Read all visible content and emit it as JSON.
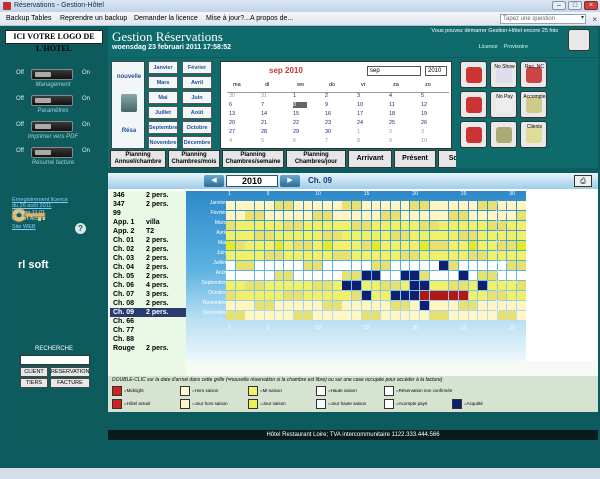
{
  "window": {
    "title": "Réservations - Gestion-Hôtel"
  },
  "menu": {
    "items": [
      "Backup Tables",
      "Reprendre un backup",
      "Demander la licence",
      "Mise à jour?...",
      "A propos de..."
    ],
    "search_placeholder": "Tapez une question",
    "close": "×"
  },
  "left": {
    "logo": "ICI VOTRE LOGO DE L'HOTEL",
    "toggles": [
      {
        "off": "Off",
        "on": "On",
        "label": "Management"
      },
      {
        "off": "Off",
        "on": "On",
        "label": "Paramètres"
      },
      {
        "off": "Off",
        "on": "On",
        "label": "Imprimer vers PDF"
      },
      {
        "off": "Off",
        "on": "On",
        "label": "Résumé facture"
      }
    ],
    "info_lines": [
      "Enregistrement licence",
      "du 26 août 2011",
      "Version  11.01",
      "Ouvert  Accès",
      "Site WEB"
    ],
    "help": "?",
    "brand": "rl soft",
    "search_label": "RECHERCHE",
    "buttons": [
      "CLIENT",
      "RESERVATION",
      "TIERS",
      "FACTURE"
    ]
  },
  "header": {
    "app": "Gestion Réservations",
    "datetime": "woensdag 23 februari 2011     17:58:52",
    "trial": "Vous pouvez démarrer Gestion-Hôtel encore 25 fois",
    "licence": "Licence",
    "licence_value": "Provisoire"
  },
  "calendar": {
    "nouvelle": "nouvelle",
    "resa": "Résa",
    "months": [
      "Janvier",
      "Février",
      "Mars",
      "Avril",
      "Mai",
      "Juin",
      "Juillet",
      "Août",
      "Septembre",
      "Octobre",
      "Novembre",
      "Décembre"
    ],
    "title": "sep 2010",
    "month_select": "sep",
    "year_select": "2010",
    "weekdays": [
      "ma",
      "di",
      "wo",
      "do",
      "vr",
      "za",
      "zo"
    ],
    "weeks": [
      [
        "30",
        "31",
        "1",
        "2",
        "3",
        "4",
        "5"
      ],
      [
        "6",
        "7",
        "8",
        "9",
        "10",
        "11",
        "12"
      ],
      [
        "13",
        "14",
        "15",
        "16",
        "17",
        "18",
        "19"
      ],
      [
        "20",
        "21",
        "22",
        "23",
        "24",
        "25",
        "26"
      ],
      [
        "27",
        "28",
        "29",
        "30",
        "1",
        "2",
        "3"
      ],
      [
        "4",
        "5",
        "6",
        "7",
        "8",
        "9",
        "10"
      ]
    ]
  },
  "tabs": [
    {
      "l1": "Planning",
      "l2": "Annuel/chambre"
    },
    {
      "l1": "Planning",
      "l2": "Chambres/mois"
    },
    {
      "l1": "Planning",
      "l2": "Chambres/semaine"
    },
    {
      "l1": "Planning",
      "l2": "Chambres/jour"
    },
    {
      "l1": "Arrivant",
      "l2": ""
    },
    {
      "l1": "Présent",
      "l2": ""
    },
    {
      "l1": "Sortant",
      "l2": ""
    },
    {
      "l1": "Libre",
      "l2": ""
    }
  ],
  "rightbuttons": [
    "",
    "No Show",
    "Rec. NC",
    "",
    "No Pay",
    "Accompte",
    "",
    "",
    "Clients"
  ],
  "planning": {
    "year": "2010",
    "room_title": "Ch. 09",
    "prev": "◀",
    "next": "▶",
    "print": "⎙",
    "rooms": [
      {
        "n": "346",
        "c": "2 pers."
      },
      {
        "n": "347",
        "c": "2 pers."
      },
      {
        "n": "99",
        "c": ""
      },
      {
        "n": "App. 1",
        "c": "villa"
      },
      {
        "n": "App. 2",
        "c": "T2"
      },
      {
        "n": "Ch. 01",
        "c": "2 pers."
      },
      {
        "n": "Ch. 02",
        "c": "2 pers."
      },
      {
        "n": "Ch. 03",
        "c": "2 pers."
      },
      {
        "n": "Ch. 04",
        "c": "2 pers."
      },
      {
        "n": "Ch. 05",
        "c": "2 pers."
      },
      {
        "n": "Ch. 06",
        "c": "4 pers."
      },
      {
        "n": "Ch. 07",
        "c": "3 pers."
      },
      {
        "n": "Ch. 08",
        "c": "2 pers."
      },
      {
        "n": "Ch. 09",
        "c": "2 pers."
      },
      {
        "n": "Ch. 66",
        "c": ""
      },
      {
        "n": "Ch. 77",
        "c": ""
      },
      {
        "n": "Ch. 88",
        "c": ""
      },
      {
        "n": "Rouge",
        "c": "2 pers."
      }
    ],
    "day_labels": [
      "1",
      "5",
      "10",
      "15",
      "20",
      "25",
      "30"
    ]
  },
  "legend": {
    "hint": "DOUBLE-CLIC sur la date d'arrivé dans cette grille (=nouvelle réservation si la chambre est libre) ou sur une case occupée pour accéder à la facture)",
    "items": [
      {
        "label": "=Midnight",
        "color": "#cc2222"
      },
      {
        "label": "=Hors saison",
        "color": "#fff8d0"
      },
      {
        "label": "=Mi-saison",
        "color": "#f1f06a"
      },
      {
        "label": "=Haute saison",
        "color": "#ffffff"
      },
      {
        "label": "=Réservation non confirmée",
        "color": "#ffffff"
      },
      {
        "label": "=Hôtel actuel",
        "color": "#cc2222"
      },
      {
        "label": "=Jour hors saison",
        "color": "#fff4c8"
      },
      {
        "label": "=Jour saison",
        "color": "#f0ee58"
      },
      {
        "label": "=Jour haute saison",
        "color": "#f4f8ff"
      },
      {
        "label": "=Acompte payé",
        "color": "#ffffff"
      },
      {
        "label": "=Acquitté",
        "color": "#102070"
      }
    ]
  },
  "footer": "Hôtel Restaurant Loire; TVA intercommunitaire 1122.333.444.566"
}
